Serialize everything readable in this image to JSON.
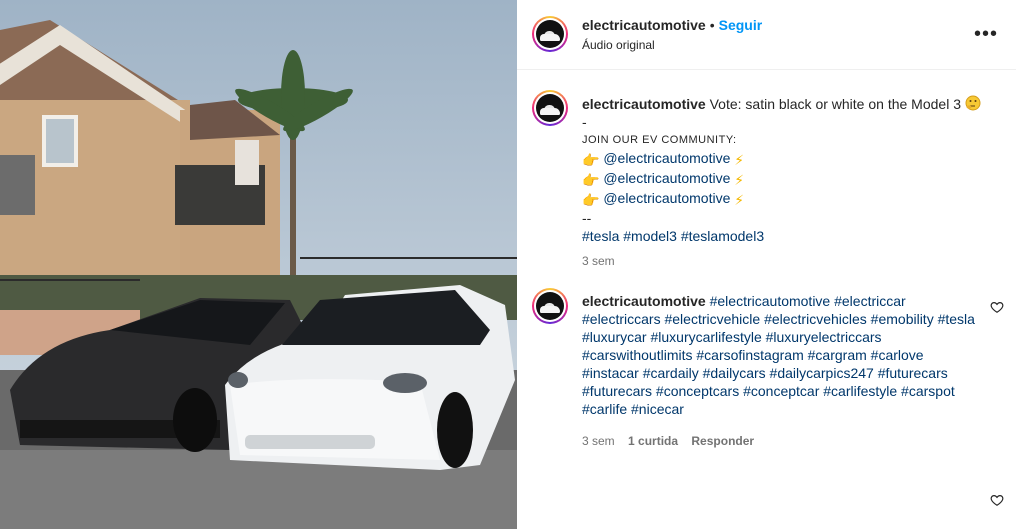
{
  "header": {
    "username": "electricautomotive",
    "separator": "•",
    "follow_label": "Seguir",
    "audio_label": "Áudio original",
    "more_label": "•••"
  },
  "caption": {
    "username": "electricautomotive",
    "text": "Vote: satin black or white on the Model 3",
    "dash": "-",
    "community_label": "JOIN OUR EV COMMUNITY:",
    "mentions": [
      "@electricautomotive",
      "@electricautomotive",
      "@electricautomotive"
    ],
    "double_dash": "--",
    "hashtags": "#tesla #model3 #teslamodel3",
    "time": "3 sem"
  },
  "comment": {
    "username": "electricautomotive",
    "hashtags": "#electricautomotive #electriccar #electriccars #electricvehicle #electricvehicles #emobility #tesla #luxurycar #luxurycarlifestyle #luxuryelectriccars #carswithoutlimits #carsofinstagram #cargram #carlove #instacar #cardaily #dailycars #dailycarpics247 #futurecars #futurecars #conceptcars #conceptcar #carlifestyle #carspot #carlife #nicecar",
    "time": "3 sem",
    "likes": "1 curtida",
    "reply_label": "Responder"
  }
}
